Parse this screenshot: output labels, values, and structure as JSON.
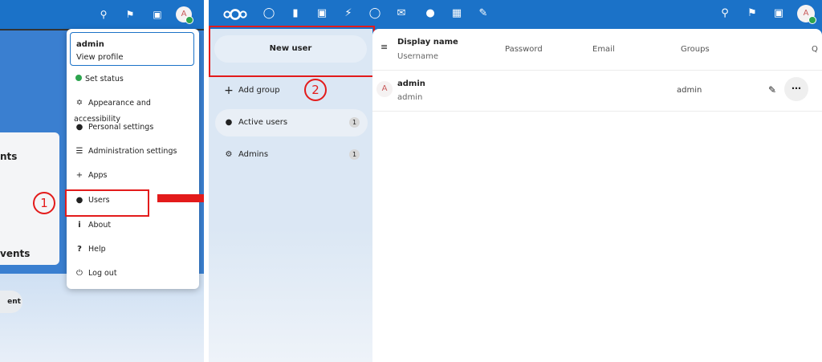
{
  "left": {
    "bg_headings": [
      "nts",
      "vents"
    ],
    "bg_button": "ent",
    "avatar_letter": "A",
    "profile": {
      "name": "admin",
      "link": "View profile"
    },
    "menu": [
      {
        "label": "Set status",
        "icon": "status-dot-icon"
      },
      {
        "label": "Appearance and accessibility",
        "icon": "accessibility-icon"
      },
      {
        "label": "Personal settings",
        "icon": "person-icon"
      },
      {
        "label": "Administration settings",
        "icon": "list-icon"
      },
      {
        "label": "Apps",
        "icon": "plus-icon"
      },
      {
        "label": "Users",
        "icon": "users-icon"
      },
      {
        "label": "About",
        "icon": "info-icon"
      },
      {
        "label": "Help",
        "icon": "question-icon"
      },
      {
        "label": "Log out",
        "icon": "power-icon"
      }
    ],
    "step_marker": "1"
  },
  "app": {
    "avatar_letter": "A",
    "new_user_label": "New user",
    "add_group_label": "Add group",
    "groups": [
      {
        "label": "Active users",
        "count": "1"
      },
      {
        "label": "Admins",
        "count": "1"
      }
    ],
    "step_marker": "2",
    "table": {
      "headers": {
        "display_name": "Display name",
        "username": "Username",
        "password": "Password",
        "email": "Email",
        "groups": "Groups",
        "quota": "Q"
      },
      "rows": [
        {
          "avatar": "A",
          "display_name": "admin",
          "username": "admin",
          "groups": "admin"
        }
      ]
    }
  },
  "colors": {
    "header_blue": "#1b72c8",
    "annotation_red": "#e31b1b",
    "online_green": "#2da44e"
  }
}
